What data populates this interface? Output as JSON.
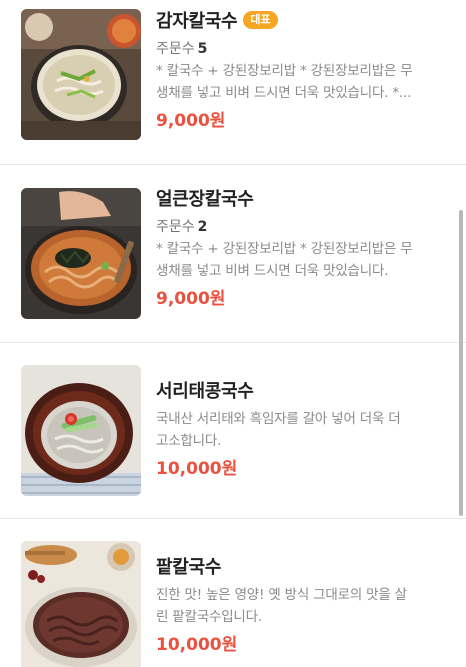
{
  "menu": {
    "items": [
      {
        "name": "감자칼국수",
        "badge": "대표",
        "orders_label": "주문수",
        "orders_count": "5",
        "desc_line1": "* 칼국수 + 강된장보리밥 * 강된장보리밥은 무",
        "desc_line2": "생채를 넣고 비벼 드시면 더욱 맛있습니다. *...",
        "price": "9,000원"
      },
      {
        "name": "얼큰장칼국수",
        "orders_label": "주문수",
        "orders_count": "2",
        "desc_line1": "* 칼국수 + 강된장보리밥 * 강된장보리밥은 무",
        "desc_line2": "생채를 넣고 비벼 드시면 더욱 맛있습니다.",
        "price": "9,000원"
      },
      {
        "name": "서리태콩국수",
        "desc_line1": "국내산 서리태와 흑임자를 갈아 넣어 더욱 더",
        "desc_line2": "고소합니다.",
        "price": "10,000원"
      },
      {
        "name": "팥칼국수",
        "desc_line1": "진한 맛! 높은 영양! 옛 방식 그대로의 맛을 살",
        "desc_line2": "린 팥칼국수입니다.",
        "price": "10,000원"
      }
    ]
  },
  "colors": {
    "price": "#e8523f",
    "badge": "#f5a623"
  }
}
